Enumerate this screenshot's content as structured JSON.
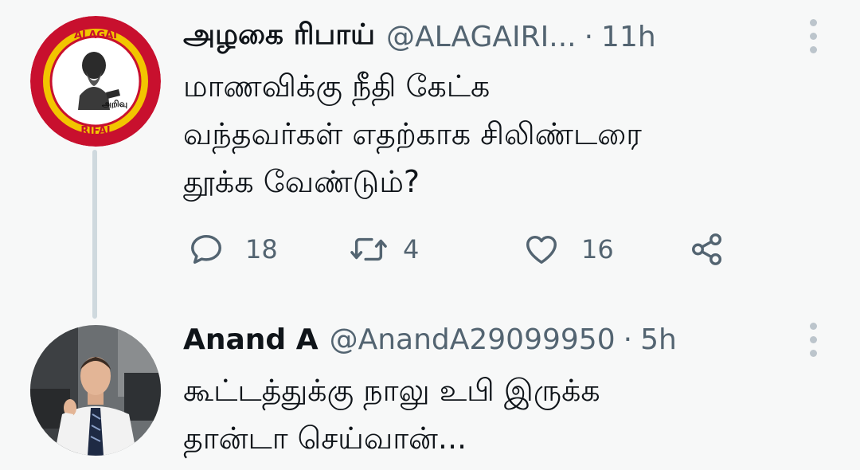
{
  "tweets": [
    {
      "name": "அழகை ரிபாய்",
      "handle": "@ALAGAIRI...",
      "time": "11h",
      "lines": [
        "மாணவிக்கு நீதி கேட்க",
        "வந்தவர்கள் எதற்காக சிலிண்டரை",
        "தூக்க வேண்டும்?"
      ],
      "avatar_text": [
        "ALAGAI",
        "RIFAI",
        "அறிவு"
      ],
      "replies": "18",
      "retweets": "4",
      "likes": "16"
    },
    {
      "name": "Anand A",
      "handle": "@AnandA29099950",
      "time": "5h",
      "lines": [
        "கூட்டத்துக்கு நாலு உபி இருக்க",
        "தான்டா செய்வான்..."
      ]
    }
  ],
  "separator": "·",
  "icons": [
    "reply-icon",
    "retweet-icon",
    "like-icon",
    "share-icon",
    "more-icon"
  ],
  "colors": {
    "text": "#0f1419",
    "secondary": "#536471",
    "logo_red": "#c8102e",
    "logo_yellow": "#f2c500"
  }
}
